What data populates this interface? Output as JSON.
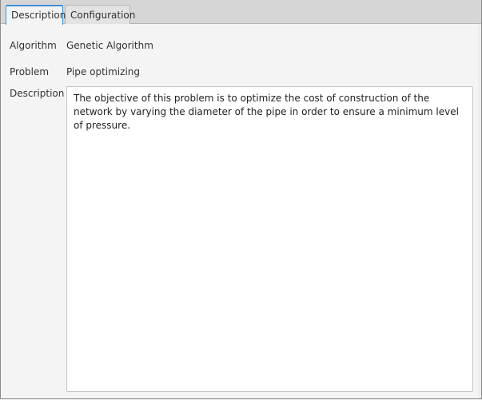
{
  "tabs": [
    {
      "label": "Description",
      "active": true
    },
    {
      "label": "Configuration",
      "active": false
    }
  ],
  "fields": {
    "algorithm": {
      "label": "Algorithm",
      "value": "Genetic Algorithm"
    },
    "problem": {
      "label": "Problem",
      "value": "Pipe optimizing"
    },
    "description": {
      "label": "Description",
      "value": "The objective of this problem is to optimize the cost of construction of the network by varying the diameter of the pipe in order to ensure a minimum level of pressure."
    }
  },
  "colors": {
    "accent": "#3d8fd1",
    "background": "#f4f4f4",
    "tabbar": "#d6d6d6"
  }
}
